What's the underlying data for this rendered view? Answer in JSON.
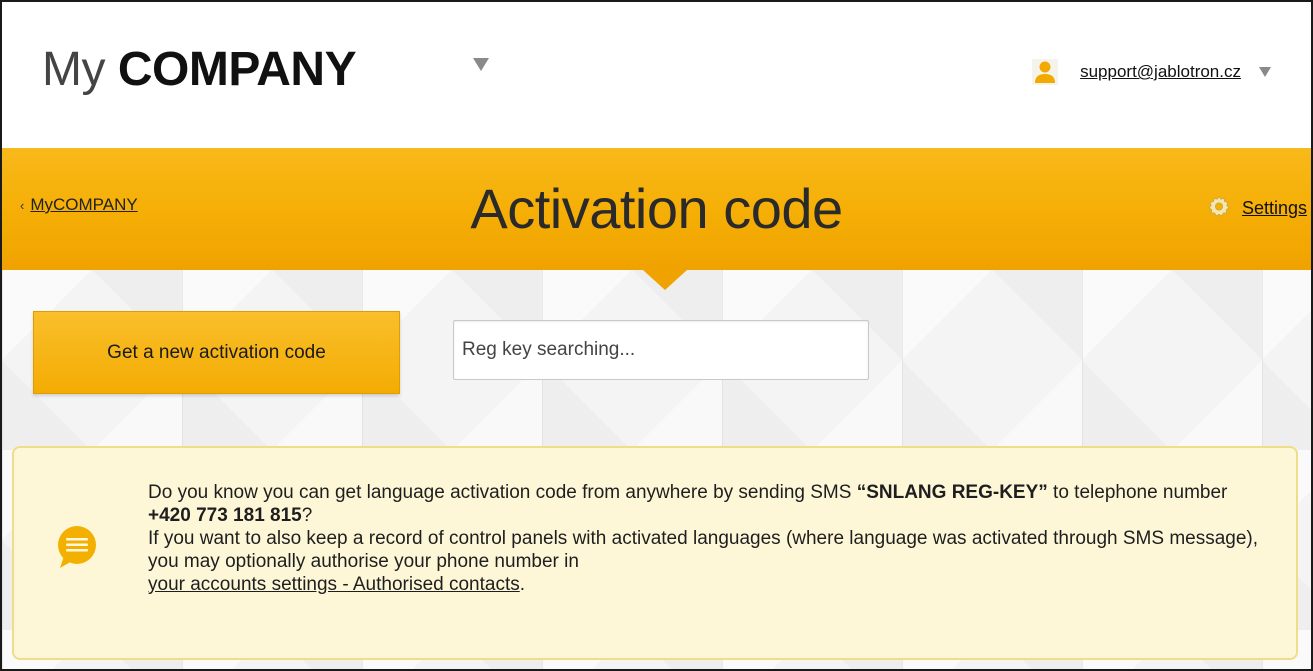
{
  "header": {
    "logo_light": "My",
    "logo_bold": "COMPANY",
    "user_email": "support@jablotron.cz"
  },
  "band": {
    "back_label": "MyCOMPANY",
    "title": "Activation code",
    "settings_label": "Settings"
  },
  "actions": {
    "new_code_label": "Get a new activation code",
    "search_placeholder": "Reg key searching..."
  },
  "info": {
    "p1_a": "Do you know you can get language activation code from anywhere by sending SMS ",
    "p1_sms": "“SNLANG REG-KEY”",
    "p1_b": " to telephone number ",
    "p1_phone": "+420 773 181 815",
    "p1_c": "?",
    "p2": "If you want to also keep a record of control panels with activated languages (where language was activated through SMS message), you may optionally authorise your phone number in",
    "p2_link": "your accounts settings - Authorised contacts",
    "p2_end": "."
  },
  "colors": {
    "accent": "#f5ae05",
    "info_bg": "#fdf7d8",
    "info_border": "#efdd8a"
  }
}
